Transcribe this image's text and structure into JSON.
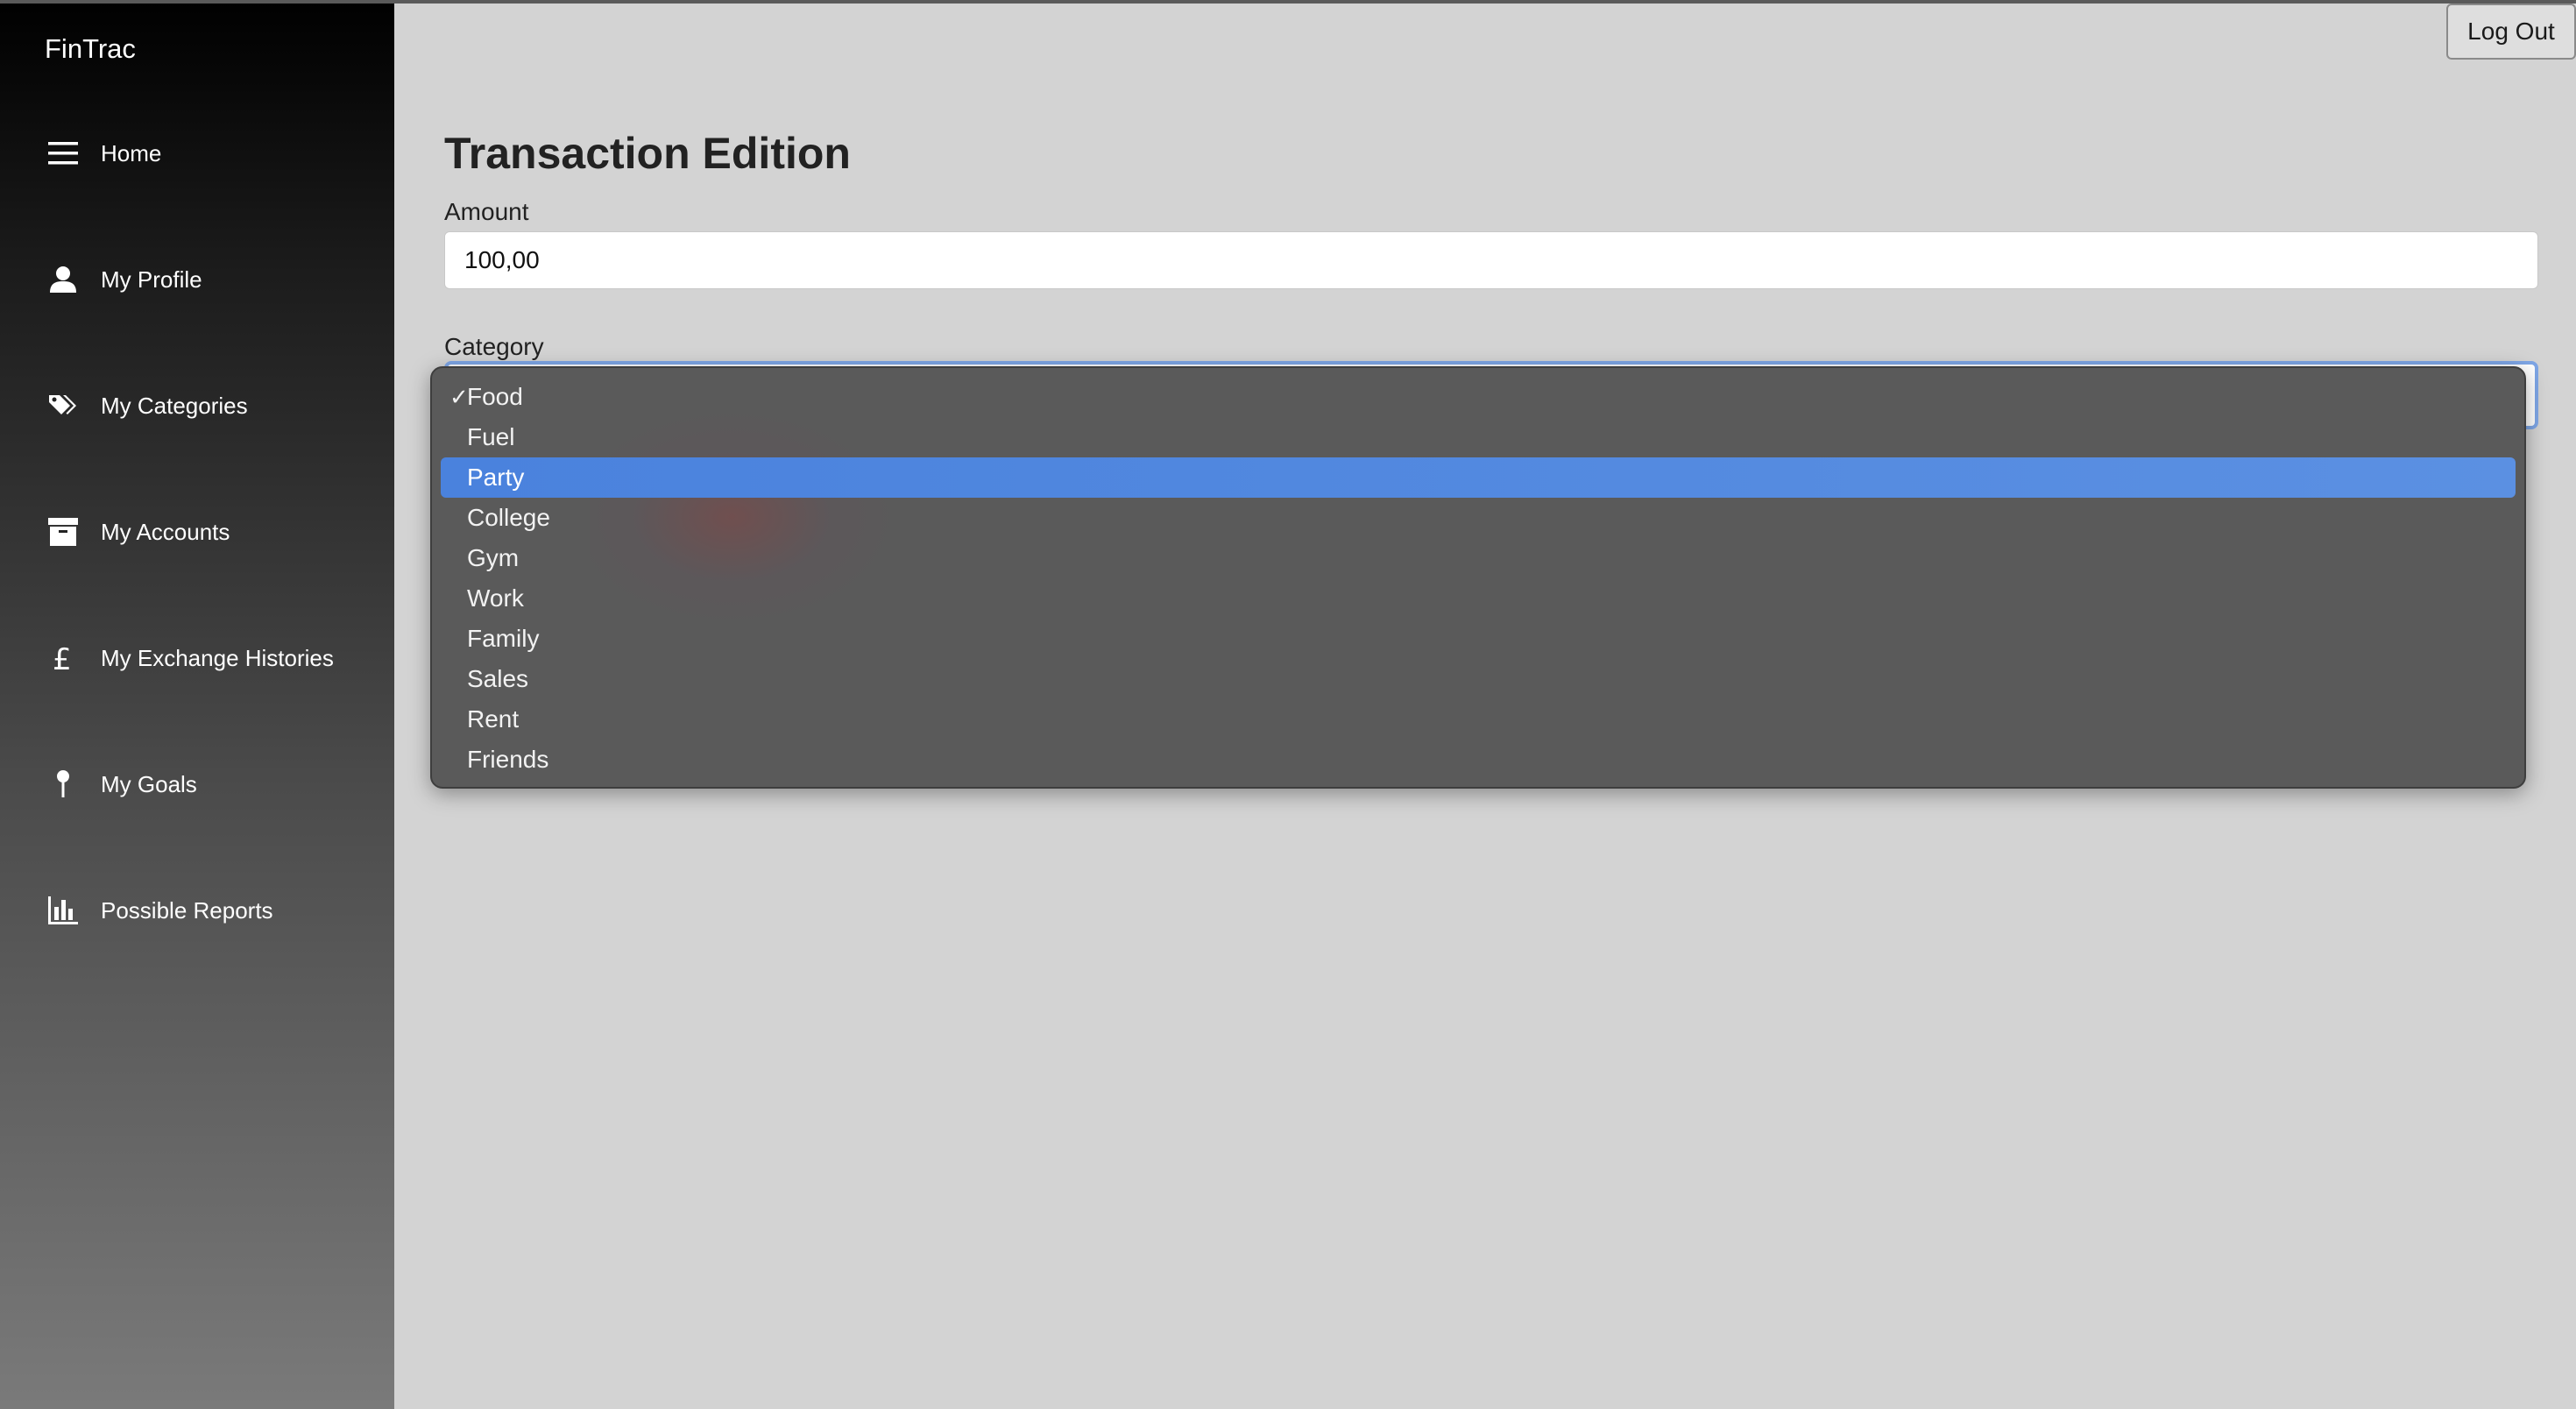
{
  "app": {
    "brand": "FinTrac"
  },
  "sidebar": {
    "items": [
      {
        "label": "Home",
        "icon": "hamburger-icon"
      },
      {
        "label": "My Profile",
        "icon": "user-icon"
      },
      {
        "label": "My Categories",
        "icon": "tags-icon"
      },
      {
        "label": "My Accounts",
        "icon": "archive-icon"
      },
      {
        "label": "My Exchange Histories",
        "icon": "pound-icon"
      },
      {
        "label": "My Goals",
        "icon": "pin-icon"
      },
      {
        "label": "Possible Reports",
        "icon": "bar-chart-icon"
      }
    ]
  },
  "header": {
    "logout_label": "Log Out"
  },
  "form": {
    "title": "Transaction Edition",
    "amount_label": "Amount",
    "amount_value": "100,00",
    "category_label": "Category",
    "category_selected": "Food",
    "category_highlighted": "Party",
    "category_options": [
      "Food",
      "Fuel",
      "Party",
      "College",
      "Gym",
      "Work",
      "Family",
      "Sales",
      "Rent",
      "Friends"
    ],
    "check_mark": "✓"
  },
  "colors": {
    "highlight": "#4a82dd",
    "focus_ring": "#7ea6e6",
    "dropdown_bg": "#5a5a5a",
    "page_bg": "#d3d3d3"
  }
}
